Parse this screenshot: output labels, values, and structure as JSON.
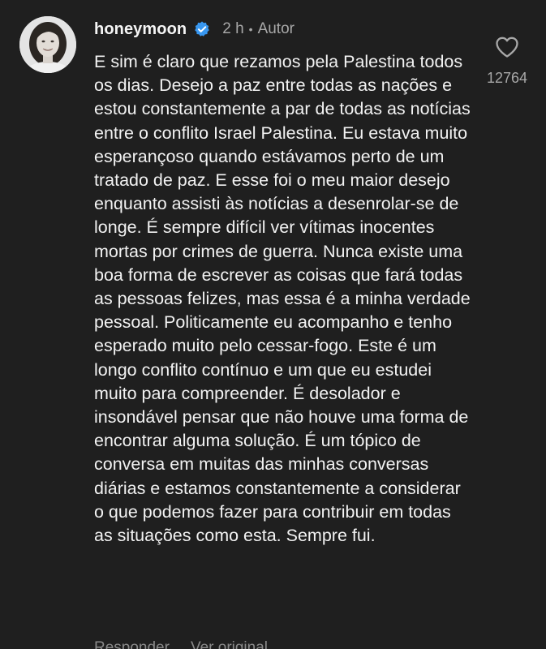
{
  "comment": {
    "username": "honeymoon",
    "verified_icon": "verified-badge-icon",
    "time": "2 h",
    "separator": "•",
    "author_tag": "Autor",
    "text": "E sim é claro que rezamos pela Palestina todos os dias. Desejo a paz entre todas as nações e estou constantemente a par de todas as notícias entre o conflito Israel Palestina. Eu estava muito esperançoso quando estávamos perto de um tratado de paz. E esse foi o meu maior desejo enquanto assisti às notícias a desenrolar-se de longe. É sempre difícil ver vítimas inocentes mortas por crimes de guerra. Nunca existe uma boa forma de escrever as coisas que fará todas as pessoas felizes, mas essa é a minha verdade pessoal. Politicamente eu acompanho e tenho esperado muito pelo cessar-fogo. Este é um longo conflito contínuo e um que eu estudei muito para compreender. É desolador e insondável pensar que não houve uma forma de encontrar alguma solução. É um tópico de conversa em muitas das minhas conversas diárias e estamos constantemente a considerar o que podemos fazer para contribuir em todas as situações como esta. Sempre fui.",
    "like_icon": "heart-outline-icon",
    "like_count": "12764",
    "actions": {
      "reply": "Responder",
      "view_original": "Ver original"
    }
  },
  "colors": {
    "background": "#1f1f1f",
    "text": "#f2f2f2",
    "muted": "#a8a8a8",
    "verified": "#3897f0"
  }
}
